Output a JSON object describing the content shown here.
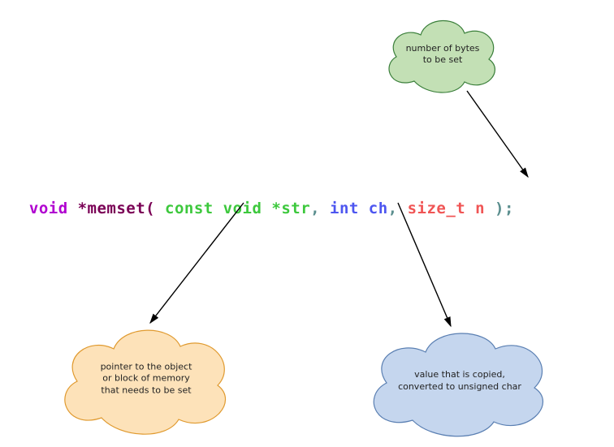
{
  "tokens": {
    "ret_type": "void",
    "star_name": " *memset( ",
    "param1": "const void *str",
    "comma1": ", ",
    "param2": "int ch",
    "comma2": ", ",
    "param3": "size_t n",
    "close": " );"
  },
  "colors": {
    "ret": "#b000d0",
    "name": "#7a0055",
    "p1": "#3dc83d",
    "p2": "#4d56f0",
    "p3": "#f05555",
    "punct": "#5a8e8e"
  },
  "clouds": {
    "top": {
      "text": "number of bytes\nto be set",
      "fill": "#c3e0b5",
      "stroke": "#3a7f3a"
    },
    "left": {
      "text": "pointer to the object\nor block of memory\nthat needs to be set",
      "fill": "#fde2b9",
      "stroke": "#e09a2f"
    },
    "right": {
      "text": "value that is copied,\nconverted to unsigned char",
      "fill": "#c5d6ee",
      "stroke": "#5a7fb2"
    }
  }
}
